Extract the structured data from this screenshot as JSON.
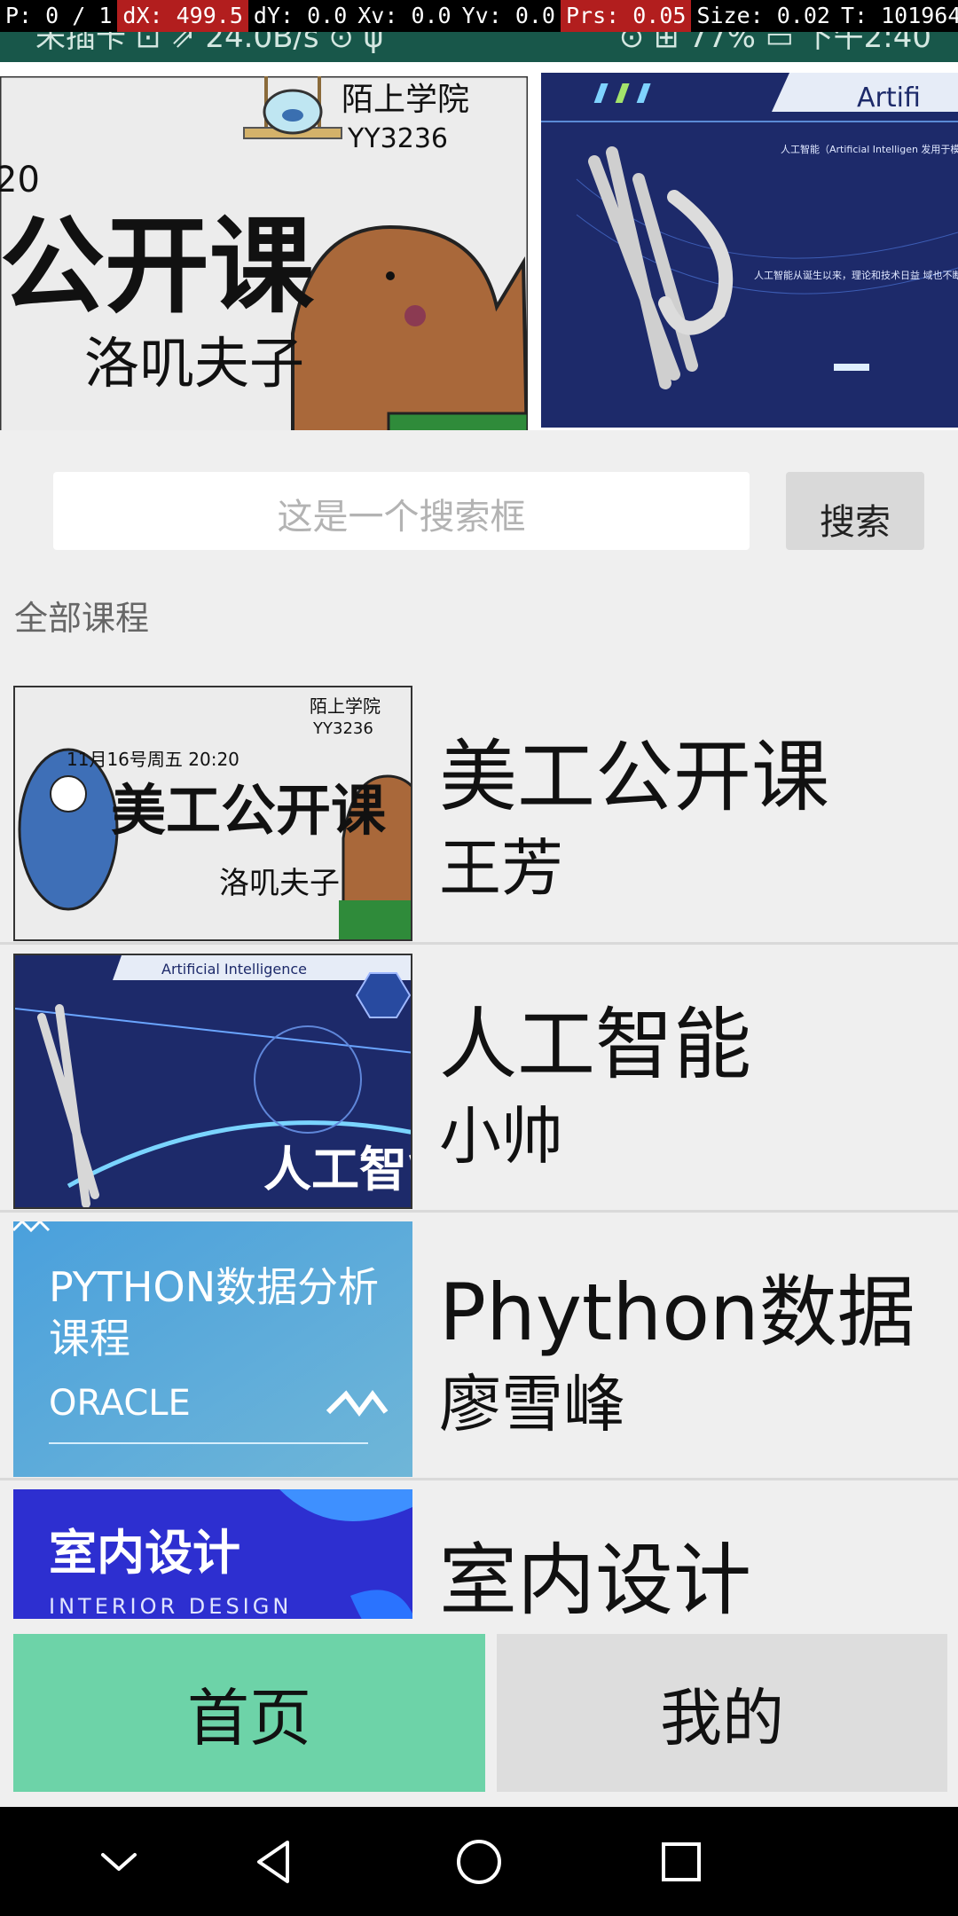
{
  "status_bar": {
    "left_text": "未插卡 ⊡ ⇗ 24.0B/s ⊙ ψ",
    "right_text": "⊙ ⊞ 77% ▭ 下午2:40"
  },
  "debug_overlay": {
    "pointer": "P: 0 / 1",
    "dx": "dX: 499.5",
    "dy": "dY: 0.0",
    "xv": "Xv: 0.0",
    "yv": "Yv: 0.0",
    "prs": "Prs: 0.05",
    "size": "Size: 0.02",
    "t": "T: 101964"
  },
  "banner": {
    "left": {
      "school": "陌上学院",
      "code": "YY3236",
      "date_fragment": "20",
      "title": "公开课",
      "teacher": "洛叽夫子"
    },
    "right": {
      "heading": "Artifi",
      "para1": "人工智能（Artificial Intelligen 发用于模拟、延伸和扩展人的 的一门新的技术科学。",
      "para2": "人工智能从诞生以来，理论和技术日益 域也不断扩大，可以设想，未来人工智 产品，将会是人类智慧的\"容器\"，也 智能。"
    }
  },
  "search": {
    "placeholder": "这是一个搜索框",
    "button_label": "搜索"
  },
  "section_title": "全部课程",
  "courses": [
    {
      "title": "美工公开课",
      "teacher": "王芳",
      "thumb_school": "陌上学院",
      "thumb_code": "YY3236",
      "thumb_date": "11月16号周五 20:20",
      "thumb_title": "美工公开课",
      "thumb_teacher": "洛叽夫子"
    },
    {
      "title": "人工智能",
      "teacher": "小帅",
      "thumb_heading": "Artificial Intelligence",
      "thumb_title": "人工智能"
    },
    {
      "title": "Phython数据",
      "teacher": "廖雪峰",
      "thumb_line1": "PYTHON数据分析",
      "thumb_line2": "课程",
      "thumb_line3": "ORACLE"
    },
    {
      "title": "室内设计",
      "teacher": "",
      "thumb_title": "室内设计",
      "thumb_sub": "INTERIOR DESIGN"
    }
  ],
  "tabs": {
    "home": "首页",
    "mine": "我的"
  },
  "colors": {
    "status_bar": "#18574a",
    "tab_home": "#6dd3a8",
    "tab_mine": "#dddddd",
    "background": "#efefef"
  },
  "nav_icons": [
    "chevron-down-icon",
    "back-icon",
    "home-circle-icon",
    "recents-square-icon"
  ]
}
